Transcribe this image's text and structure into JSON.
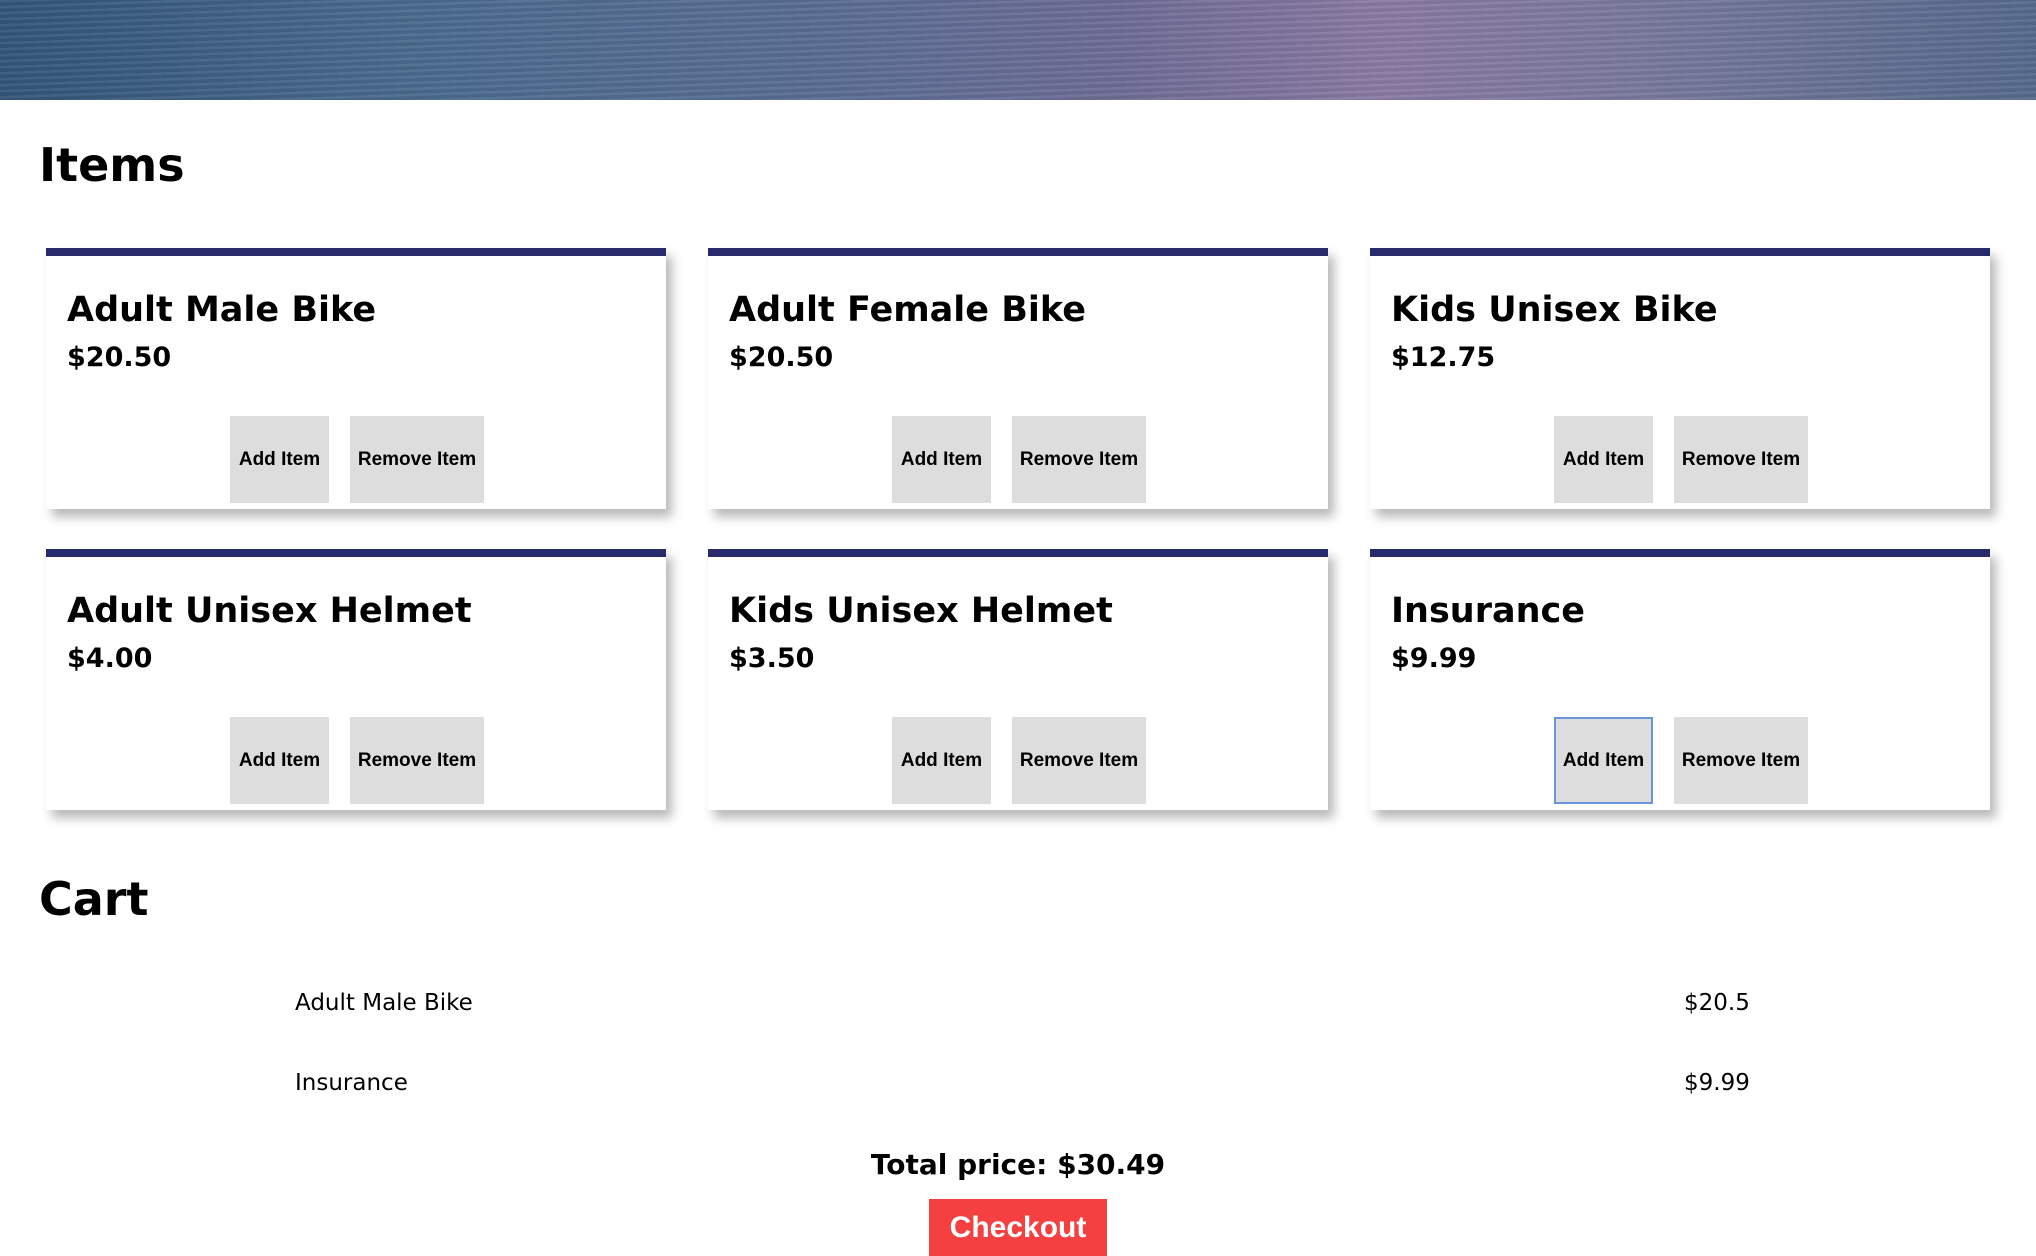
{
  "items_section": {
    "title": "Items",
    "items": [
      {
        "name": "Adult Male Bike",
        "price": "$20.50",
        "add_label": "Add Item",
        "remove_label": "Remove Item"
      },
      {
        "name": "Adult Female Bike",
        "price": "$20.50",
        "add_label": "Add Item",
        "remove_label": "Remove Item"
      },
      {
        "name": "Kids Unisex Bike",
        "price": "$12.75",
        "add_label": "Add Item",
        "remove_label": "Remove Item"
      },
      {
        "name": "Adult Unisex Helmet",
        "price": "$4.00",
        "add_label": "Add Item",
        "remove_label": "Remove Item"
      },
      {
        "name": "Kids Unisex Helmet",
        "price": "$3.50",
        "add_label": "Add Item",
        "remove_label": "Remove Item"
      },
      {
        "name": "Insurance",
        "price": "$9.99",
        "add_label": "Add Item",
        "remove_label": "Remove Item"
      }
    ]
  },
  "cart": {
    "title": "Cart",
    "lines": [
      {
        "name": "Adult Male Bike",
        "price": "$20.5"
      },
      {
        "name": "Insurance",
        "price": "$9.99"
      }
    ],
    "total_text": "Total price: $30.49",
    "checkout_label": "Checkout"
  },
  "colors": {
    "card_top_border": "#292a6b",
    "button_bg": "#dddddd",
    "checkout_bg": "#f44040",
    "focus_ring": "#6a95dc"
  }
}
